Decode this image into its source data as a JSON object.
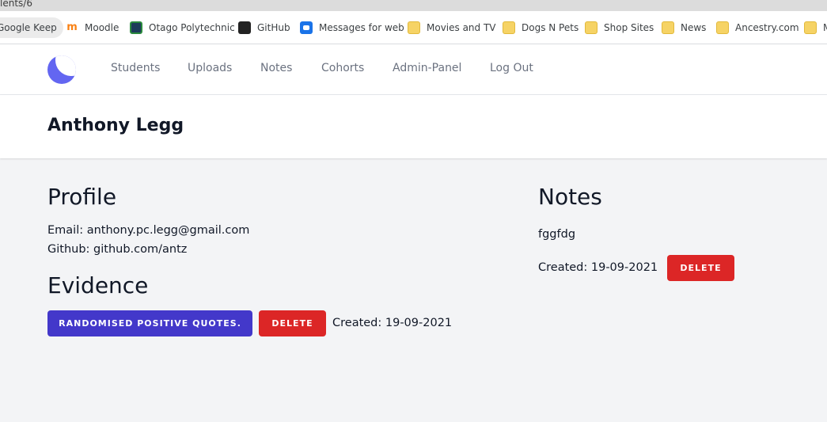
{
  "browser": {
    "url_fragment": "lents/6",
    "bookmarks": [
      {
        "label": "Google Keep",
        "icon": "google-keep-icon"
      },
      {
        "label": "Moodle",
        "icon": "moodle-icon"
      },
      {
        "label": "Otago Polytechnic",
        "icon": "otago-polytechnic-icon"
      },
      {
        "label": "GitHub",
        "icon": "github-icon"
      },
      {
        "label": "Messages for web",
        "icon": "messages-icon"
      },
      {
        "label": "Movies and TV",
        "icon": "folder-icon"
      },
      {
        "label": "Dogs N Pets",
        "icon": "folder-icon"
      },
      {
        "label": "Shop Sites",
        "icon": "folder-icon"
      },
      {
        "label": "News",
        "icon": "folder-icon"
      },
      {
        "label": "Ancestry.com",
        "icon": "folder-icon"
      },
      {
        "label": "M",
        "icon": "folder-icon"
      }
    ]
  },
  "nav": {
    "logo": "app-logo",
    "links": [
      "Students",
      "Uploads",
      "Notes",
      "Cohorts",
      "Admin-Panel",
      "Log Out"
    ]
  },
  "header": {
    "title": "Anthony Legg"
  },
  "profile": {
    "heading": "Profile",
    "email": "Email: anthony.pc.legg@gmail.com",
    "github": "Github: github.com/antz"
  },
  "evidence": {
    "heading": "Evidence",
    "items": [
      {
        "title": "Randomised positive quotes.",
        "delete_label": "Delete",
        "created": "Created: 19-09-2021"
      }
    ]
  },
  "notes": {
    "heading": "Notes",
    "items": [
      {
        "text": "fggfdg",
        "created": "Created: 19-09-2021",
        "delete_label": "Delete"
      }
    ]
  },
  "colors": {
    "primary": "#4338ca",
    "danger": "#dc2626",
    "logo": "#6366f1",
    "page_bg": "#f3f4f6"
  }
}
